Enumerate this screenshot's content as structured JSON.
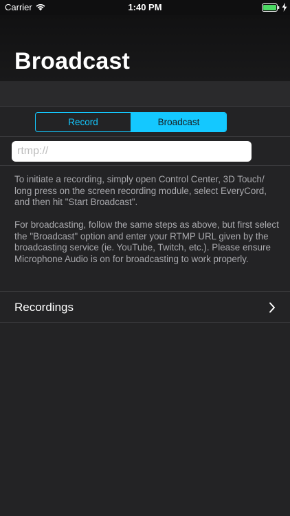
{
  "status_bar": {
    "carrier": "Carrier",
    "time": "1:40 PM",
    "icons": [
      "wifi-icon",
      "battery-icon",
      "bolt-icon"
    ],
    "battery_color": "#4cd964"
  },
  "header": {
    "title": "Broadcast"
  },
  "segments": {
    "record_label": "Record",
    "broadcast_label": "Broadcast",
    "selected": "Broadcast",
    "accent_color": "#14c8ff"
  },
  "url_field": {
    "placeholder": "rtmp://",
    "value": ""
  },
  "instructions": {
    "paragraph_1": "To initiate a recording, simply open Control Center, 3D Touch/ long press on the screen recording module, select EveryCord, and then hit \"Start Broadcast\".",
    "paragraph_2": "For broadcasting, follow the same steps as above, but first select the \"Broadcast\" option and enter your RTMP URL given by the broadcasting service (ie. YouTube, Twitch, etc.). Please ensure Microphone Audio is on for broadcasting to work properly."
  },
  "recordings": {
    "label": "Recordings",
    "icon": "chevron-right-icon"
  }
}
